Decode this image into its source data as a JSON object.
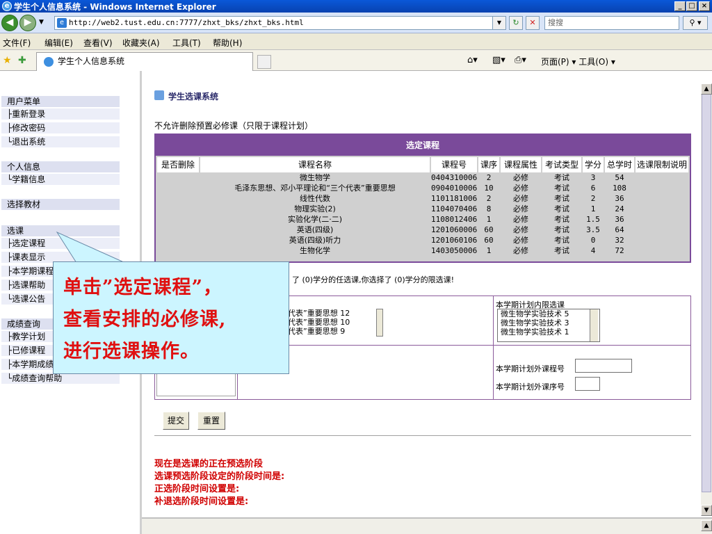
{
  "window": {
    "title": "学生个人信息系统 - Windows Internet Explorer",
    "controls": [
      "_",
      "□",
      "×"
    ]
  },
  "address": {
    "url": "http://web2.tust.edu.cn:7777/zhxt_bks/zhxt_bks.html",
    "search_placeholder": "搜搜"
  },
  "menu": {
    "items": [
      "文件(F)",
      "编辑(E)",
      "查看(V)",
      "收藏夹(A)",
      "工具(T)",
      "帮助(H)"
    ]
  },
  "favbar": {
    "tab_title": "学生个人信息系统",
    "tools": "页面(P) ▾   工具(O) ▾"
  },
  "sidebar": {
    "sections": [
      {
        "title": "用户菜单",
        "items": [
          "├重新登录",
          "├修改密码",
          "└退出系统"
        ]
      },
      {
        "title": "个人信息",
        "items": [
          "└学籍信息"
        ]
      },
      {
        "title": "选择教材",
        "items": []
      },
      {
        "title": "选课",
        "items": [
          "├选定课程",
          "├课表显示",
          "├本学期课程",
          "├选课帮助",
          "└选课公告"
        ]
      },
      {
        "title": "成绩查询",
        "items": [
          "├教学计划",
          "├已修课程",
          "├本学期成绩",
          "└成绩查询帮助"
        ]
      }
    ]
  },
  "main": {
    "heading": "学生选课系统",
    "notice": "不允许删除预置必修课（只限于课程计划）",
    "table_title": "选定课程",
    "columns": [
      "是否删除",
      "课程名称",
      "课程号",
      "课序",
      "课程属性",
      "考试类型",
      "学分",
      "总学时",
      "选课限制说明"
    ],
    "rows": [
      {
        "name": "微生物学",
        "code": "0404310006",
        "seq": "2",
        "attr": "必修",
        "exam": "考试",
        "credit": "3",
        "hours": "54"
      },
      {
        "name": "毛泽东思想、邓小平理论和“三个代表”重要思想",
        "code": "0904010006",
        "seq": "10",
        "attr": "必修",
        "exam": "考试",
        "credit": "6",
        "hours": "108"
      },
      {
        "name": "线性代数",
        "code": "1101181006",
        "seq": "2",
        "attr": "必修",
        "exam": "考试",
        "credit": "2",
        "hours": "36"
      },
      {
        "name": "物理实验(2)",
        "code": "1104070406",
        "seq": "8",
        "attr": "必修",
        "exam": "考试",
        "credit": "1",
        "hours": "24"
      },
      {
        "name": "实验化学(二·二)",
        "code": "1108012406",
        "seq": "1",
        "attr": "必修",
        "exam": "考试",
        "credit": "1.5",
        "hours": "36"
      },
      {
        "name": "英语(四级)",
        "code": "1201060006",
        "seq": "60",
        "attr": "必修",
        "exam": "考试",
        "credit": "3.5",
        "hours": "64"
      },
      {
        "name": "英语(四级)听力",
        "code": "1201060106",
        "seq": "60",
        "attr": "必修",
        "exam": "考试",
        "credit": "0",
        "hours": "32"
      },
      {
        "name": "生物化学",
        "code": "1403050006",
        "seq": "1",
        "attr": "必修",
        "exam": "考试",
        "credit": "4",
        "hours": "72"
      }
    ],
    "selection_summary": "了 (0)学分的任选课,你选择了 (0)学分的限选课!",
    "elective_list": [
      {
        "text": "个代表”重要思想",
        "num": "12"
      },
      {
        "text": "个代表”重要思想",
        "num": "10"
      },
      {
        "text": "个代表”重要思想",
        "num": "9"
      }
    ],
    "limited_title": "本学期计划内限选课",
    "limited_list": [
      {
        "text": "微生物学实验技术",
        "num": "5"
      },
      {
        "text": "微生物学实验技术",
        "num": "3"
      },
      {
        "text": "微生物学实验技术",
        "num": "1"
      }
    ],
    "outside_code_label": "本学期计划外课程号",
    "outside_seq_label": "本学期计划外课序号",
    "submit_label": "提交",
    "reset_label": "重置",
    "status_lines": [
      "现在是选课的正在预选阶段",
      "选课预选阶段设定的阶段时间是:",
      "正选阶段时间设置是:",
      "补退选阶段时间设置是:"
    ]
  },
  "callout": {
    "lines": [
      "单击”选定课程”，",
      "查看安排的必修课,",
      "进行选课操作。"
    ]
  }
}
